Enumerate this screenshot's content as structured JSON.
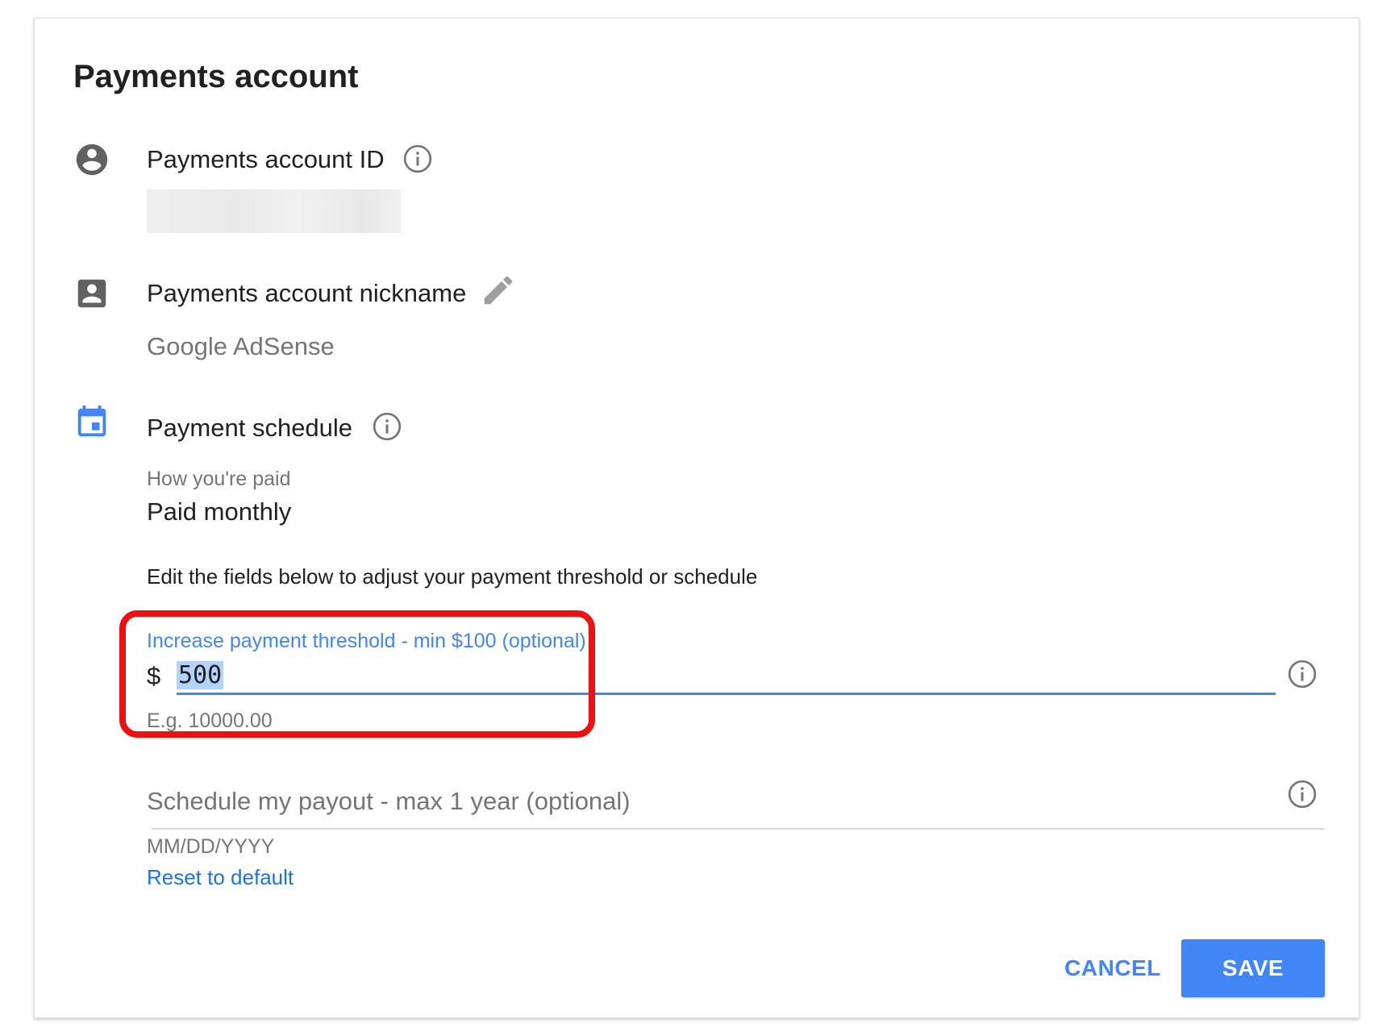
{
  "card": {
    "title": "Payments account"
  },
  "account_id": {
    "label": "Payments account ID",
    "icon": "account-circle-icon",
    "info_icon": "info-icon"
  },
  "nickname": {
    "label": "Payments account nickname",
    "icon": "contact-box-icon",
    "edit_icon": "pencil-icon",
    "value": "Google AdSense"
  },
  "schedule": {
    "label": "Payment schedule",
    "icon": "calendar-icon",
    "info_icon": "info-icon",
    "how_paid_label": "How you're paid",
    "how_paid_value": "Paid monthly",
    "edit_note": "Edit the fields below to adjust your payment threshold or schedule"
  },
  "threshold": {
    "label": "Increase payment threshold - min $100 (optional)",
    "currency_symbol": "$",
    "value": "500",
    "hint": "E.g. 10000.00"
  },
  "payout": {
    "placeholder": "Schedule my payout - max 1 year (optional)",
    "hint": "MM/DD/YYYY",
    "reset_link": "Reset to default"
  },
  "actions": {
    "cancel_label": "CANCEL",
    "save_label": "SAVE"
  },
  "colors": {
    "accent_blue": "#4285f4",
    "link_blue": "#1a73e8",
    "highlight_red": "#ee1111",
    "icon_grey": "#616161",
    "text_grey": "#757575"
  }
}
